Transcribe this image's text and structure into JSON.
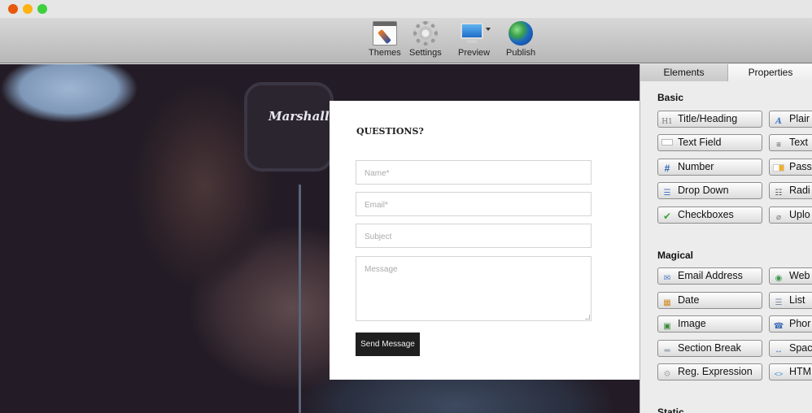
{
  "window": {
    "traffic_lights": {
      "close": "#e8580c",
      "minimize": "#fdb311",
      "maximize": "#3dd13d"
    }
  },
  "toolbar": {
    "items": [
      {
        "label": "Themes",
        "icon": "themes-icon"
      },
      {
        "label": "Settings",
        "icon": "gear-icon"
      },
      {
        "label": "Preview",
        "icon": "monitor-icon",
        "has_dropdown": true
      },
      {
        "label": "Publish",
        "icon": "globe-icon"
      }
    ]
  },
  "preview": {
    "background_brand_text": "Marshall",
    "form": {
      "title": "QUESTIONS?",
      "fields": [
        {
          "placeholder": "Name*",
          "value": ""
        },
        {
          "placeholder": "Email*",
          "value": ""
        },
        {
          "placeholder": "Subject",
          "value": ""
        },
        {
          "placeholder": "Message",
          "value": "",
          "multiline": true
        }
      ],
      "submit_label": "Send Message",
      "submit_color": "#1f1f1f"
    }
  },
  "panel": {
    "tabs": [
      {
        "label": "Elements",
        "active": false
      },
      {
        "label": "Properties",
        "active": true
      }
    ],
    "sections": [
      {
        "title": "Basic",
        "items": [
          {
            "label": "Title/Heading",
            "icon": "heading-icon",
            "glyph": "H1"
          },
          {
            "label": "Plair",
            "icon": "plain-text-icon",
            "glyph": "A"
          },
          {
            "label": "Text Field",
            "icon": "text-field-icon",
            "glyph": ""
          },
          {
            "label": "Text",
            "icon": "paragraph-icon",
            "glyph": "≡"
          },
          {
            "label": "Number",
            "icon": "hash-icon",
            "glyph": "#"
          },
          {
            "label": "Pass",
            "icon": "password-key-icon",
            "glyph": ""
          },
          {
            "label": "Drop Down",
            "icon": "dropdown-icon",
            "glyph": "☰"
          },
          {
            "label": "Radi",
            "icon": "radio-list-icon",
            "glyph": "☷"
          },
          {
            "label": "Checkboxes",
            "icon": "checkmark-icon",
            "glyph": "✔"
          },
          {
            "label": "Uplo",
            "icon": "paperclip-icon",
            "glyph": "⌀"
          }
        ]
      },
      {
        "title": "Magical",
        "items": [
          {
            "label": "Email Address",
            "icon": "envelope-icon",
            "glyph": "✉"
          },
          {
            "label": "Web",
            "icon": "web-globe-icon",
            "glyph": "◉"
          },
          {
            "label": "Date",
            "icon": "calendar-icon",
            "glyph": "▦"
          },
          {
            "label": "List",
            "icon": "list-icon",
            "glyph": "☰"
          },
          {
            "label": "Image",
            "icon": "image-icon",
            "glyph": "▣"
          },
          {
            "label": "Phor",
            "icon": "phone-icon",
            "glyph": "☎"
          },
          {
            "label": "Section Break",
            "icon": "section-break-icon",
            "glyph": "═"
          },
          {
            "label": "Spac",
            "icon": "spacer-icon",
            "glyph": "↔"
          },
          {
            "label": "Reg. Expression",
            "icon": "regex-gear-icon",
            "glyph": "⚙"
          },
          {
            "label": "HTM",
            "icon": "html-code-icon",
            "glyph": "<>"
          }
        ]
      },
      {
        "title": "Static",
        "items": []
      }
    ]
  }
}
